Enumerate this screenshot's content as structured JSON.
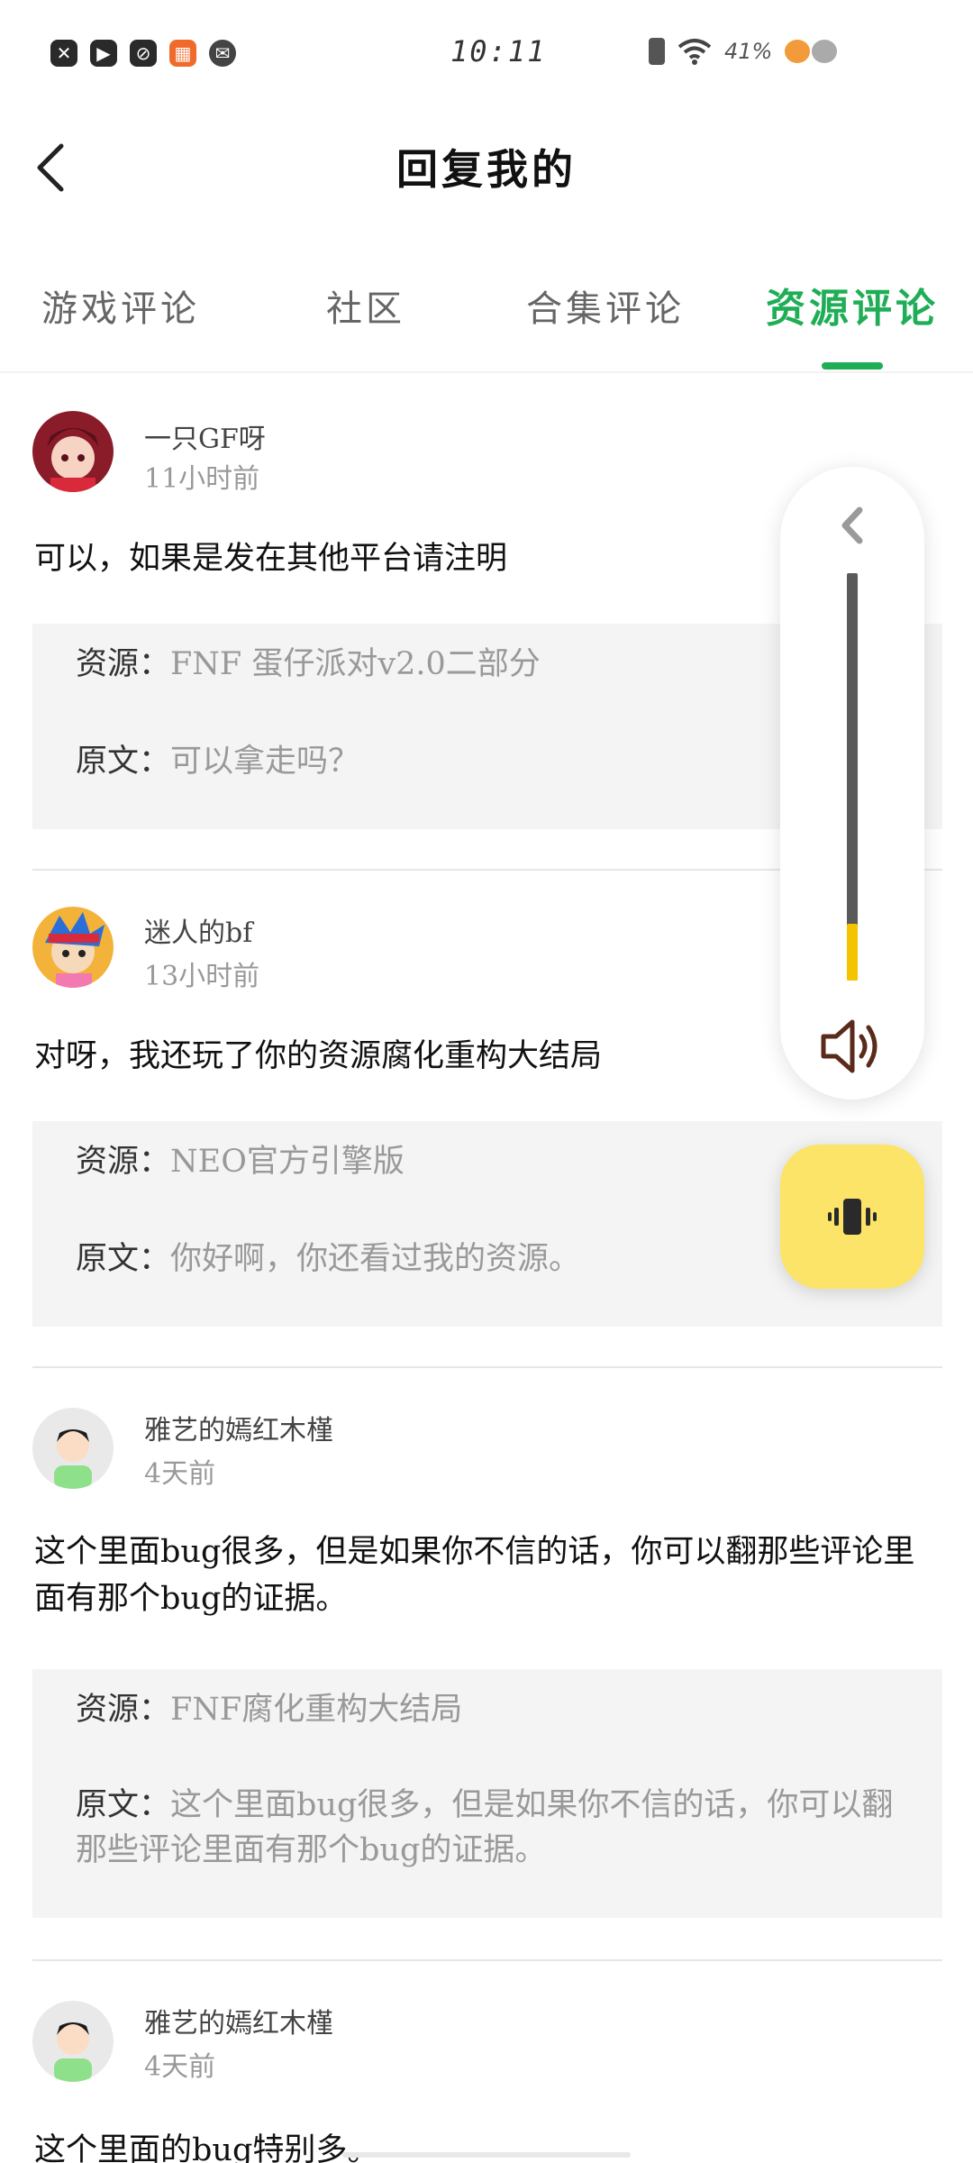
{
  "status_bar": {
    "time": "10:11",
    "battery": "41%"
  },
  "header": {
    "title": "回复我的"
  },
  "tabs": [
    {
      "label": "游戏评论",
      "active": false
    },
    {
      "label": "社区",
      "active": false
    },
    {
      "label": "合集评论",
      "active": false
    },
    {
      "label": "资源评论",
      "active": true
    }
  ],
  "accent_color": "#1fae56",
  "comments": [
    {
      "user": "一只GF呀",
      "time": "11小时前",
      "text": "可以，如果是发在其他平台请注明",
      "resource_label": "资源：",
      "resource": "FNF 蛋仔派对v2.0二部分",
      "original_label": "原文：",
      "original": "可以拿走吗？"
    },
    {
      "user": "迷人的bf",
      "time": "13小时前",
      "text": "对呀，我还玩了你的资源腐化重构大结局",
      "resource_label": "资源：",
      "resource": "NEO官方引擎版",
      "original_label": "原文：",
      "original": "你好啊，你还看过我的资源。"
    },
    {
      "user": "雅艺的嫣红木槿",
      "time": "4天前",
      "text": "这个里面bug很多，但是如果你不信的话，你可以翻那些评论里面有那个bug的证据。",
      "resource_label": "资源：",
      "resource": "FNF腐化重构大结局",
      "original_label": "原文：",
      "original": "这个里面bug很多，但是如果你不信的话，你可以翻那些评论里面有那个bug的证据。"
    },
    {
      "user": "雅艺的嫣红木槿",
      "time": "4天前",
      "text": "这个里面的bug特别多。"
    }
  ],
  "volume": {
    "level": 0.14,
    "track_color": "#5a5a5a",
    "fill_color": "#f5c400",
    "speaker_icon": "speaker-icon",
    "vibrate_color": "#fce468"
  }
}
